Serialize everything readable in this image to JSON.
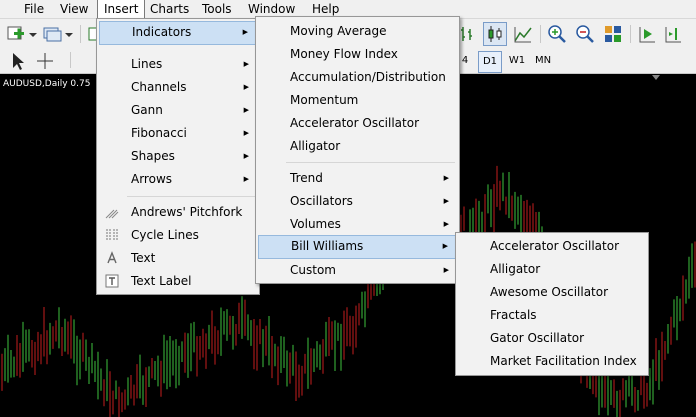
{
  "menubar": [
    "File",
    "View",
    "Insert",
    "Charts",
    "Tools",
    "Window",
    "Help"
  ],
  "timeframes": [
    "4",
    "D1",
    "W1",
    "MN"
  ],
  "symbol_label": "AUDUSD,Daily  0.75",
  "insert_menu": {
    "items": [
      "Indicators",
      "Lines",
      "Channels",
      "Gann",
      "Fibonacci",
      "Shapes",
      "Arrows",
      "Andrews' Pitchfork",
      "Cycle Lines",
      "Text",
      "Text Label"
    ]
  },
  "indicators_menu": {
    "items": [
      "Moving Average",
      "Money Flow Index",
      "Accumulation/Distribution",
      "Momentum",
      "Accelerator Oscillator",
      "Alligator",
      "Trend",
      "Oscillators",
      "Volumes",
      "Bill Williams",
      "Custom"
    ]
  },
  "bill_williams_menu": {
    "items": [
      "Accelerator Oscillator",
      "Alligator",
      "Awesome Oscillator",
      "Fractals",
      "Gator Oscillator",
      "Market Facilitation Index"
    ]
  },
  "colors": {
    "bull": "#3ec23e",
    "bear": "#c41e1e",
    "background": "#000000",
    "highlight": "#cce0f4"
  }
}
